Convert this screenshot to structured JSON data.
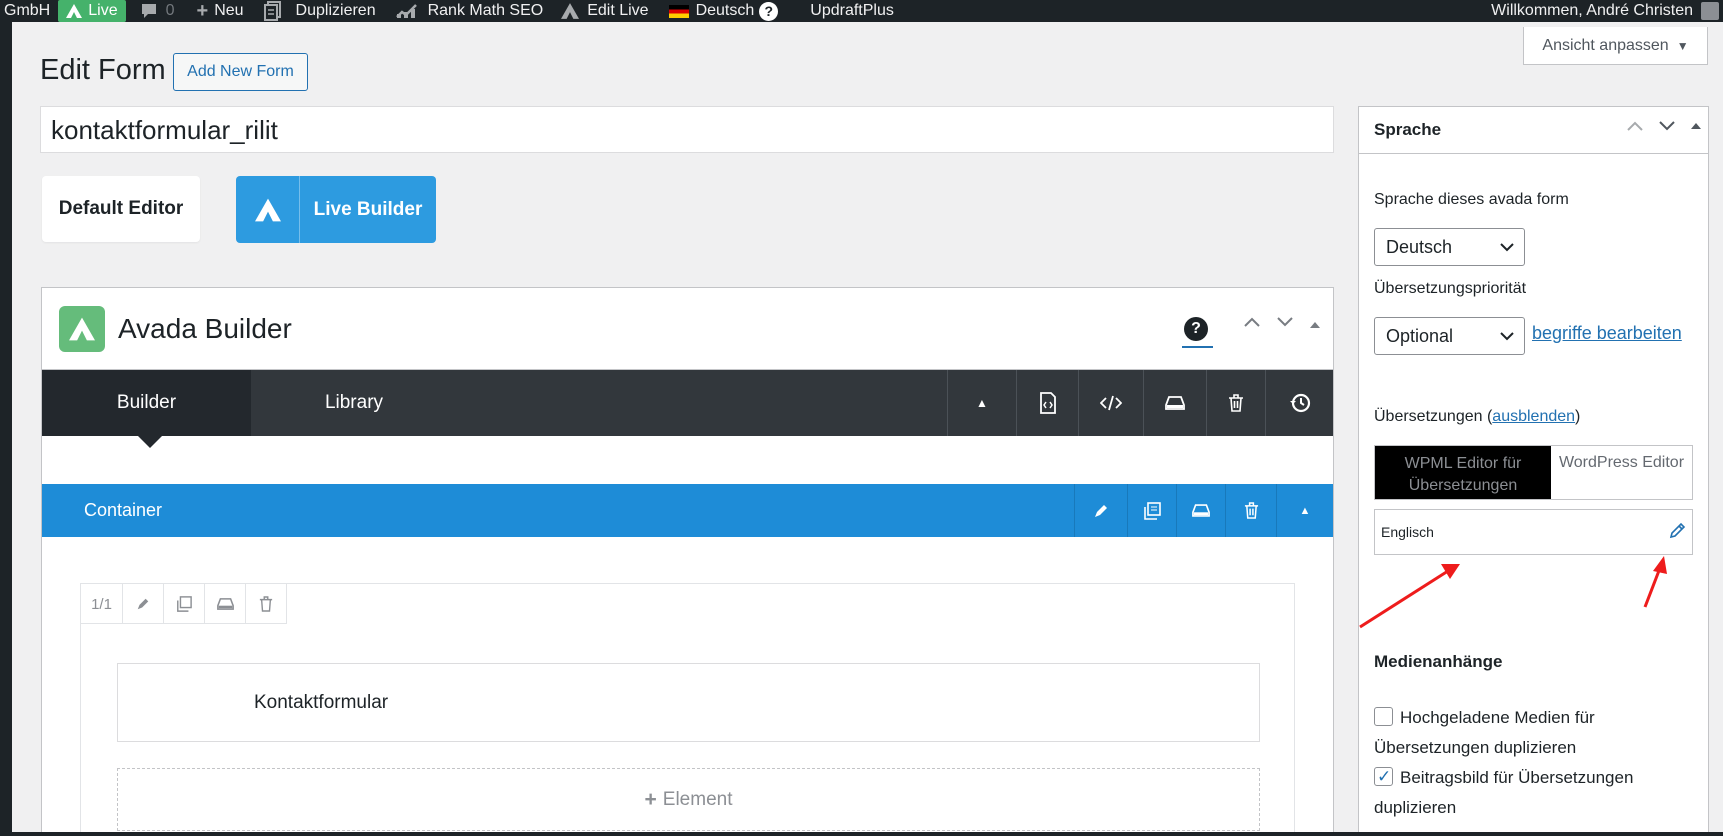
{
  "adminbar": {
    "site_name": "GmbH",
    "live_label": "Live",
    "comments_count": "0",
    "new_label": "Neu",
    "duplicate_label": "Duplizieren",
    "seo_label": "Rank Math SEO",
    "edit_live_label": "Edit Live",
    "language_label": "Deutsch",
    "updraft_label": "UpdraftPlus",
    "welcome_text": "Willkommen, André Christen"
  },
  "screen_options": {
    "label": "Ansicht anpassen"
  },
  "page": {
    "title": "Edit Form",
    "add_new_label": "Add New Form",
    "form_title_value": "kontaktformular_rilit"
  },
  "editor_switch": {
    "default_label": "Default Editor",
    "live_label": "Live Builder"
  },
  "builder": {
    "title": "Avada Builder",
    "tabs": [
      {
        "label": "Builder"
      },
      {
        "label": "Library"
      }
    ],
    "container_label": "Container",
    "column_size": "1/1",
    "element_label": "Kontaktformular",
    "add_element_label": "Element"
  },
  "sidebar": {
    "title": "Sprache",
    "language_label": "Sprache dieses avada form",
    "language_value": "Deutsch",
    "priority_label": "Übersetzungspriorität",
    "priority_value": "Optional",
    "edit_terms_link": "begriffe bearbeiten",
    "translations_label": "Übersetzungen (",
    "translations_hide_link": "ausblenden",
    "translations_label_end": ")",
    "tab_wpml": "WPML Editor für Übersetzungen",
    "tab_wordpress": "WordPress Editor",
    "translation_language": "Englisch",
    "media_title": "Medienanhänge",
    "media_option_1": "Hochgeladene Medien für Übersetzungen duplizieren",
    "media_option_1_checked": false,
    "media_option_2": "Beitragsbild für Übersetzungen duplizieren",
    "media_option_2_checked": true
  },
  "colors": {
    "admin_bar": "#1d2327",
    "live_green": "#45b26b",
    "avada_green": "#65bc7b",
    "live_builder_blue": "#2d9be0",
    "container_blue": "#1e8cd7",
    "link_blue": "#2271b1",
    "annotation_red": "#ee1c1c"
  }
}
